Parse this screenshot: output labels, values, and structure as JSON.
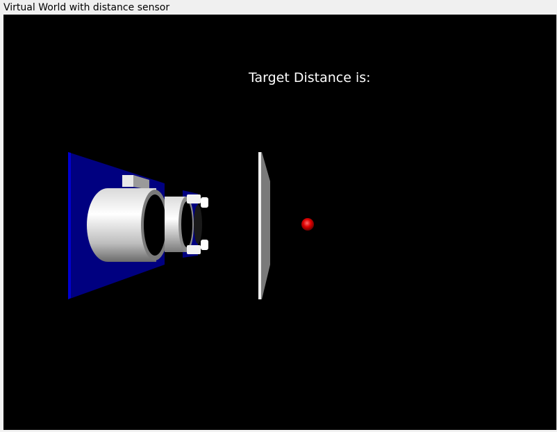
{
  "window": {
    "title": "Virtual World with distance sensor"
  },
  "scene": {
    "label": "Target Distance is:",
    "colors": {
      "background": "#000000",
      "board": "#000080",
      "sensor_body": "#ffffff",
      "target_plate": "#e6e6e6",
      "target_ball": "#e00000"
    }
  }
}
